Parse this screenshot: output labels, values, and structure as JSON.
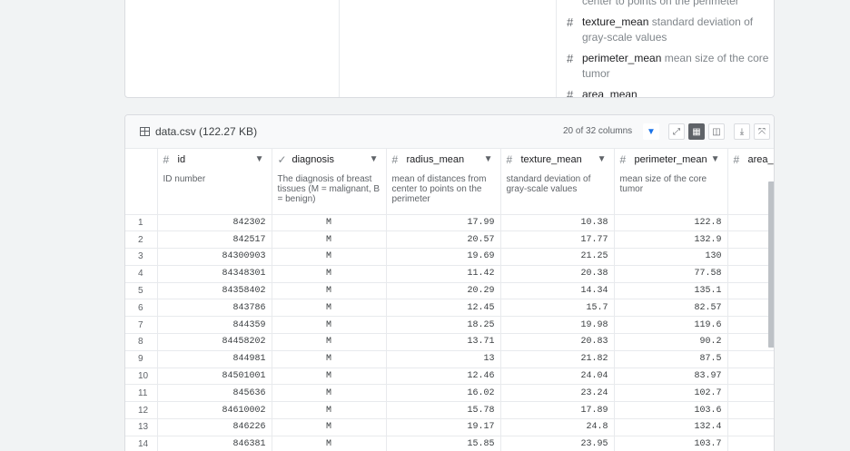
{
  "column_list": [
    {
      "name": "",
      "description": "center to points on the perimeter"
    },
    {
      "name": "texture_mean",
      "description": "standard deviation of gray-scale values"
    },
    {
      "name": "perimeter_mean",
      "description": "mean size of the core tumor"
    },
    {
      "name": "area_mean",
      "description": ""
    }
  ],
  "file": {
    "title": "data.csv (122.27 KB)",
    "column_count": "20 of 32 columns"
  },
  "toolbar": {
    "icons": [
      "filter-icon",
      "expand-icon",
      "table-view-icon",
      "column-view-icon",
      "download-icon",
      "fullscreen-icon"
    ]
  },
  "columns": [
    {
      "name": "id",
      "type_icon": "#",
      "description": "ID number"
    },
    {
      "name": "diagnosis",
      "type_icon": "✓",
      "description": "The diagnosis of breast tissues (M = malignant, B = benign)"
    },
    {
      "name": "radius_mean",
      "type_icon": "#",
      "description": "mean of distances from center to points on the perimeter"
    },
    {
      "name": "texture_mean",
      "type_icon": "#",
      "description": "standard deviation of gray-scale values"
    },
    {
      "name": "perimeter_mean",
      "type_icon": "#",
      "description": "mean size of the core tumor"
    },
    {
      "name": "area_",
      "type_icon": "#",
      "description": ""
    }
  ],
  "rows": [
    [
      "1",
      "842302",
      "M",
      "17.99",
      "10.38",
      "122.8"
    ],
    [
      "2",
      "842517",
      "M",
      "20.57",
      "17.77",
      "132.9"
    ],
    [
      "3",
      "84300903",
      "M",
      "19.69",
      "21.25",
      "130"
    ],
    [
      "4",
      "84348301",
      "M",
      "11.42",
      "20.38",
      "77.58"
    ],
    [
      "5",
      "84358402",
      "M",
      "20.29",
      "14.34",
      "135.1"
    ],
    [
      "6",
      "843786",
      "M",
      "12.45",
      "15.7",
      "82.57"
    ],
    [
      "7",
      "844359",
      "M",
      "18.25",
      "19.98",
      "119.6"
    ],
    [
      "8",
      "84458202",
      "M",
      "13.71",
      "20.83",
      "90.2"
    ],
    [
      "9",
      "844981",
      "M",
      "13",
      "21.82",
      "87.5"
    ],
    [
      "10",
      "84501001",
      "M",
      "12.46",
      "24.04",
      "83.97"
    ],
    [
      "11",
      "845636",
      "M",
      "16.02",
      "23.24",
      "102.7"
    ],
    [
      "12",
      "84610002",
      "M",
      "15.78",
      "17.89",
      "103.6"
    ],
    [
      "13",
      "846226",
      "M",
      "19.17",
      "24.8",
      "132.4"
    ],
    [
      "14",
      "846381",
      "M",
      "15.85",
      "23.95",
      "103.7"
    ]
  ]
}
